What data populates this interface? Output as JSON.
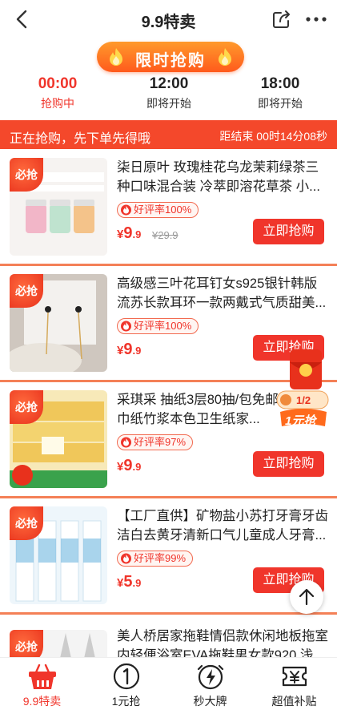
{
  "header": {
    "title": "9.9特卖"
  },
  "banner": {
    "text": "限时抢购"
  },
  "slots": [
    {
      "time": "00:00",
      "state": "抢购中"
    },
    {
      "time": "12:00",
      "state": "即将开始"
    },
    {
      "time": "18:00",
      "state": "即将开始"
    }
  ],
  "notice": {
    "left": "正在抢购，先下单先得哦",
    "right": "距结束 00时14分08秒"
  },
  "products": [
    {
      "tag": "必抢",
      "name": "柒日原叶 玫瑰桂花乌龙茉莉绿茶三种口味混合装 冷萃即溶花草茶 小...",
      "rate": "好评率100%",
      "price_int": "9",
      "price_dec": ".9",
      "old_price": "¥29.9",
      "button": "立即抢购"
    },
    {
      "tag": "必抢",
      "name": "高级感三叶花耳钉女s925银针韩版流苏长款耳环一款两戴式气质甜美...",
      "rate": "好评率100%",
      "price_int": "9",
      "price_dec": ".9",
      "old_price": "",
      "button": "立即抢购"
    },
    {
      "tag": "必抢",
      "name": "采琪采 抽纸3层80抽/包免邮整箱面巾纸竹浆本色卫生纸家...",
      "rate": "好评率97%",
      "price_int": "9",
      "price_dec": ".9",
      "old_price": "",
      "button": "立即抢购"
    },
    {
      "tag": "必抢",
      "name": "【工厂直供】矿物盐小苏打牙膏牙齿洁白去黄牙清新口气儿童成人牙膏...",
      "rate": "好评率99%",
      "price_int": "5",
      "price_dec": ".9",
      "old_price": "",
      "button": "立即抢购"
    },
    {
      "tag": "必抢",
      "name": "美人桥居家拖鞋情侣款休闲地板拖室内轻便浴室EVA拖鞋男女款920 浅...",
      "rate": "",
      "price_int": "",
      "price_dec": "",
      "old_price": "",
      "button": ""
    }
  ],
  "redpacket": {
    "count": "1/2",
    "label": "1元抢"
  },
  "tabs": [
    {
      "label": "9.9特卖",
      "icon": "basket-icon"
    },
    {
      "label": "1元抢",
      "icon": "coin-one-icon"
    },
    {
      "label": "秒大牌",
      "icon": "lightning-clock-icon"
    },
    {
      "label": "超值补贴",
      "icon": "ticket-yen-icon"
    }
  ],
  "colors": {
    "accent": "#f0352b",
    "orange": "#ff7a22",
    "white": "#ffffff"
  }
}
